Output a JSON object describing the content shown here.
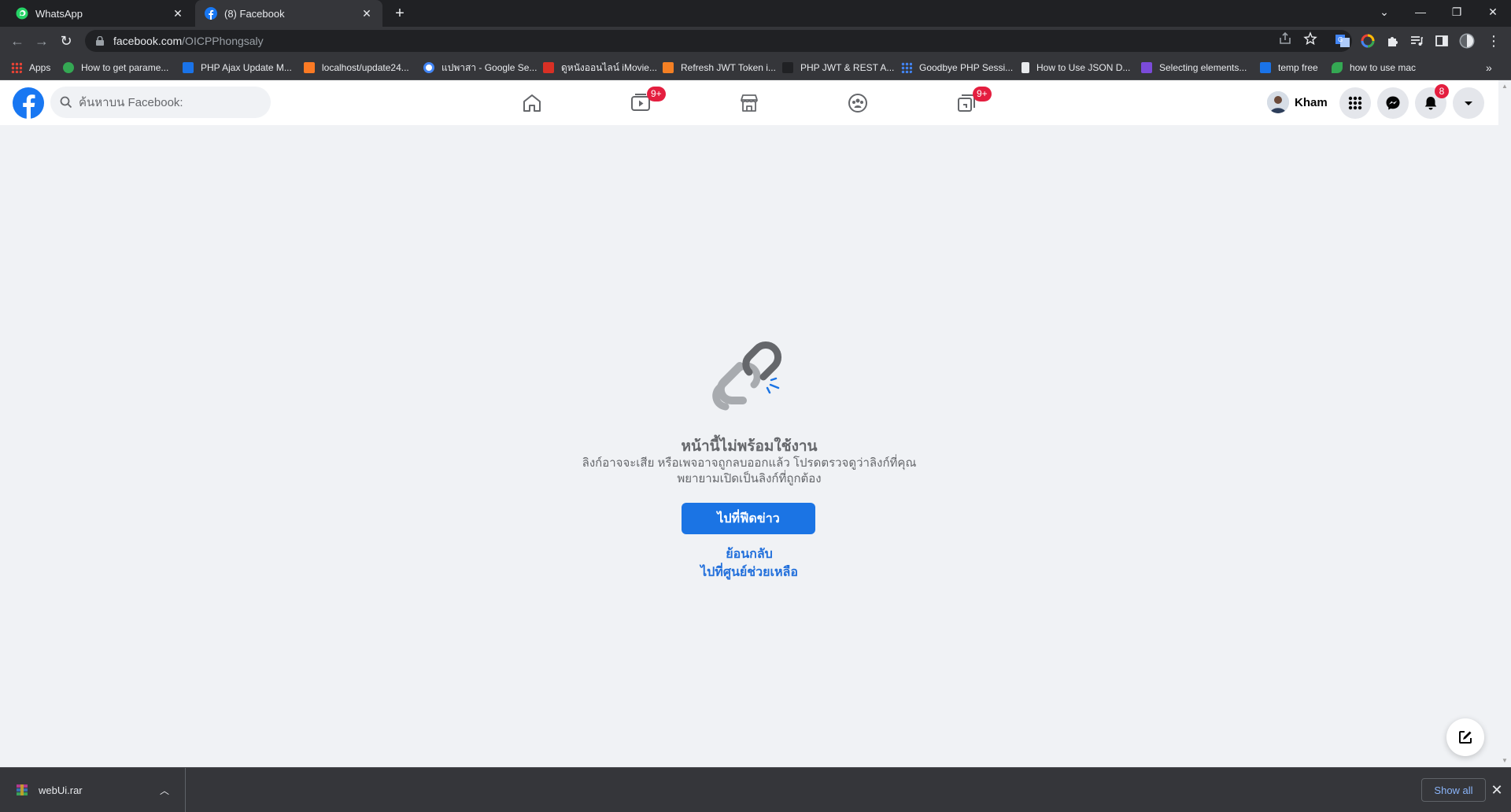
{
  "browser": {
    "tabs": [
      {
        "title": "WhatsApp",
        "icon": "whatsapp-icon",
        "active": false
      },
      {
        "title": "(8) Facebook",
        "icon": "facebook-icon",
        "active": true
      }
    ],
    "url_host": "facebook.com",
    "url_path": "/OICPPhongsaly",
    "bookmarks": [
      {
        "label": "Apps",
        "icon": "apps-grid-icon",
        "color": "#8ab4f8"
      },
      {
        "label": "How to get parame...",
        "icon": "link-icon",
        "color": "#34a853"
      },
      {
        "label": "PHP Ajax Update M...",
        "icon": "w-icon",
        "color": "#1a73e8"
      },
      {
        "label": "localhost/update24...",
        "icon": "xampp-icon",
        "color": "#fb7a24"
      },
      {
        "label": "แปพาสา - Google Se...",
        "icon": "google-icon",
        "color": "#ffffff"
      },
      {
        "label": "ดูหนังออนไลน์ iMovie...",
        "icon": "imovie-icon",
        "color": "#d93025"
      },
      {
        "label": "Refresh JWT Token i...",
        "icon": "stack-icon",
        "color": "#f48024"
      },
      {
        "label": "PHP JWT & REST A...",
        "icon": "doc-icon",
        "color": "#202124"
      },
      {
        "label": "Goodbye PHP Sessi...",
        "icon": "dots-icon",
        "color": "#4285f4"
      },
      {
        "label": "How to Use JSON D...",
        "icon": "page-icon",
        "color": "#e8eaed"
      },
      {
        "label": "Selecting elements...",
        "icon": "d-icon",
        "color": "#7b4bd9"
      },
      {
        "label": "temp free",
        "icon": "bolt-icon",
        "color": "#1a73e8"
      },
      {
        "label": "how to use mac",
        "icon": "leaf-icon",
        "color": "#34a853"
      }
    ]
  },
  "facebook": {
    "search_placeholder": "ค้นหาบน Facebook:",
    "nav_badges": {
      "watch": "9+",
      "gaming": "9+"
    },
    "profile_name": "Kham",
    "notification_count": "8"
  },
  "error_page": {
    "title": "หน้านี้ไม่พร้อมใช้งาน",
    "description": "ลิงก์อาจจะเสีย หรือเพจอาจถูกลบออกแล้ว โปรดตรวจดูว่าลิงก์ที่คุณพยายามเปิดเป็นลิงก์ที่ถูกต้อง",
    "primary_button": "ไปที่ฟีดข่าว",
    "back_link": "ย้อนกลับ",
    "help_link": "ไปที่ศูนย์ช่วยเหลือ"
  },
  "download_shelf": {
    "file_name": "webUi.rar",
    "show_all": "Show all"
  },
  "colors": {
    "fb_blue": "#1877f2",
    "button_blue": "#1b74e4",
    "badge_red": "#e41e3f",
    "page_bg": "#f0f2f5"
  }
}
